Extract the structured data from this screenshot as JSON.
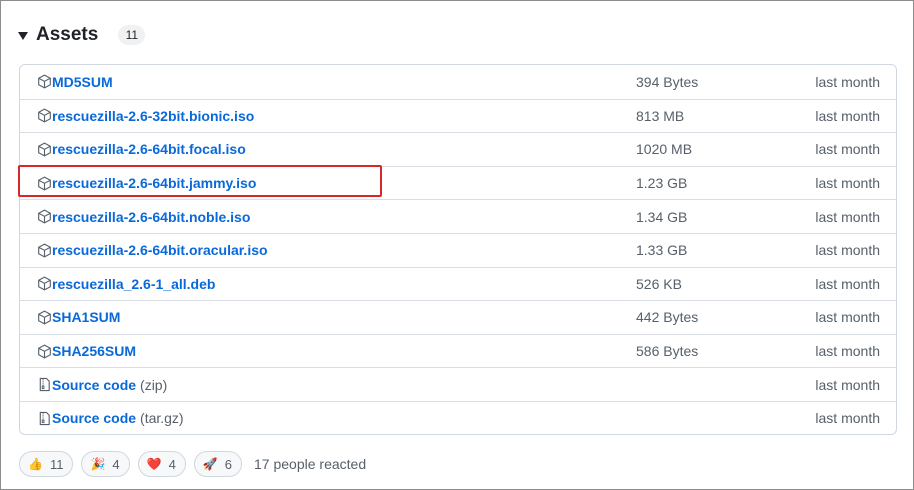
{
  "assets": {
    "title": "Assets",
    "count": "11",
    "rows": [
      {
        "name": "MD5SUM",
        "ext": "",
        "size": "394 Bytes",
        "date": "last month",
        "icon": "package-icon"
      },
      {
        "name": "rescuezilla-2.6-32bit.bionic.iso",
        "ext": "",
        "size": "813 MB",
        "date": "last month",
        "icon": "package-icon"
      },
      {
        "name": "rescuezilla-2.6-64bit.focal.iso",
        "ext": "",
        "size": "1020 MB",
        "date": "last month",
        "icon": "package-icon"
      },
      {
        "name": "rescuezilla-2.6-64bit.jammy.iso",
        "ext": "",
        "size": "1.23 GB",
        "date": "last month",
        "icon": "package-icon"
      },
      {
        "name": "rescuezilla-2.6-64bit.noble.iso",
        "ext": "",
        "size": "1.34 GB",
        "date": "last month",
        "icon": "package-icon"
      },
      {
        "name": "rescuezilla-2.6-64bit.oracular.iso",
        "ext": "",
        "size": "1.33 GB",
        "date": "last month",
        "icon": "package-icon"
      },
      {
        "name": "rescuezilla_2.6-1_all.deb",
        "ext": "",
        "size": "526 KB",
        "date": "last month",
        "icon": "package-icon"
      },
      {
        "name": "SHA1SUM",
        "ext": "",
        "size": "442 Bytes",
        "date": "last month",
        "icon": "package-icon"
      },
      {
        "name": "SHA256SUM",
        "ext": "",
        "size": "586 Bytes",
        "date": "last month",
        "icon": "package-icon"
      },
      {
        "name": "Source code",
        "ext": "(zip)",
        "size": "",
        "date": "last month",
        "icon": "file-zip-icon"
      },
      {
        "name": "Source code",
        "ext": "(tar.gz)",
        "size": "",
        "date": "last month",
        "icon": "file-zip-icon"
      }
    ]
  },
  "reactions": {
    "items": [
      {
        "emoji": "👍",
        "count": "11",
        "icon": "thumbs-up-icon"
      },
      {
        "emoji": "🎉",
        "count": "4",
        "icon": "party-popper-icon"
      },
      {
        "emoji": "❤️",
        "count": "4",
        "icon": "heart-icon"
      },
      {
        "emoji": "🚀",
        "count": "6",
        "icon": "rocket-icon"
      }
    ],
    "summary": "17 people reacted"
  },
  "colors": {
    "link": "#0969da",
    "muted": "#57606a",
    "highlight": "#d62828"
  }
}
